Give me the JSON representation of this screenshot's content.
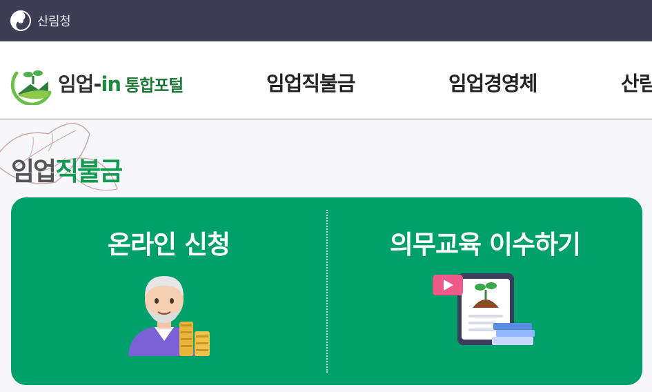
{
  "gov_bar": {
    "agency_name": "산림청",
    "emblem_icon": "korea-government-emblem-icon"
  },
  "header": {
    "logo": {
      "name_prefix": "임업-",
      "name_in": "in",
      "name_portal": "통합포털",
      "icon": "sprout-hill-logo-icon"
    },
    "nav": [
      {
        "label": "임업직불금"
      },
      {
        "label": "임업경영체"
      },
      {
        "label": "산림"
      }
    ]
  },
  "section": {
    "title_part1": "임업",
    "title_part2": "직불금"
  },
  "cards": [
    {
      "title": "온라인 신청",
      "icon": "elderly-man-with-coins-icon"
    },
    {
      "title": "의무교육 이수하기",
      "icon": "tablet-video-sprout-books-icon"
    }
  ],
  "colors": {
    "gov_bar": "#3d3d55",
    "panel": "#00a06a",
    "accent_green": "#0f9a4f"
  }
}
